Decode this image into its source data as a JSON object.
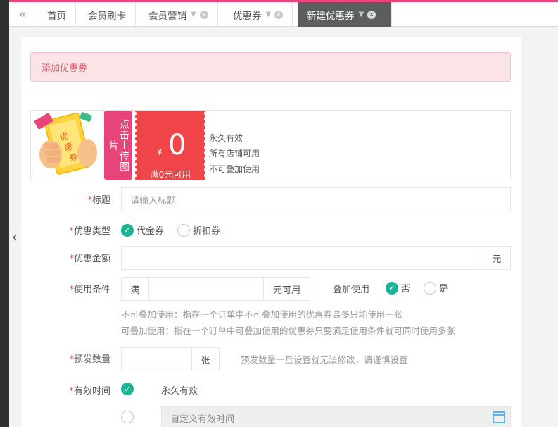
{
  "tabs": {
    "back_icon": "double-chevron-left-icon",
    "items": [
      {
        "label": "首页",
        "active": false,
        "pinned": false,
        "closable": false
      },
      {
        "label": "会员刷卡",
        "active": false,
        "pinned": false,
        "closable": false
      },
      {
        "label": "会员营销",
        "active": false,
        "pinned": true,
        "closable": true
      },
      {
        "label": "优惠券",
        "active": false,
        "pinned": true,
        "closable": true
      },
      {
        "label": "新建优惠券",
        "active": true,
        "pinned": true,
        "closable": true
      }
    ]
  },
  "alert": {
    "text": "添加优惠券"
  },
  "preview": {
    "image_icon": "coupon-hand-illustration",
    "upload_label": "点击上传图片",
    "coupon": {
      "currency": "¥",
      "amount": "0",
      "condition": "满0元可用"
    },
    "info": [
      "永久有效",
      "所有店铺可用",
      "不可叠加使用"
    ]
  },
  "form": {
    "required_mark": "*",
    "title": {
      "label": "标题",
      "placeholder": "请输入标题",
      "value": ""
    },
    "type": {
      "label": "优惠类型",
      "options": [
        {
          "label": "代金券",
          "checked": true
        },
        {
          "label": "折扣券",
          "checked": false
        }
      ]
    },
    "amount": {
      "label": "优惠金额",
      "value": "",
      "unit": "元"
    },
    "condition": {
      "label": "使用条件",
      "prefix": "满",
      "value": "",
      "suffix": "元可用",
      "stack_label": "叠加使用",
      "stack_options": [
        {
          "label": "否",
          "checked": true
        },
        {
          "label": "是",
          "checked": false
        }
      ],
      "help": [
        "不可叠加使用：指在一个订单中不可叠加使用的优惠券最多只能使用一张",
        "可叠加使用：指在一个订单中可叠加使用的优惠券只要满足使用条件就可同时使用多张"
      ]
    },
    "quantity": {
      "label": "预发数量",
      "value": "",
      "unit": "张",
      "help": "预发数量一旦设置就无法修改，请谨慎设置"
    },
    "validity": {
      "label": "有效时间",
      "options": [
        {
          "label": "永久有效",
          "checked": true
        },
        {
          "label": "",
          "checked": false
        }
      ],
      "custom_placeholder": "自定义有效时间"
    }
  },
  "colors": {
    "accent": "#e8447a",
    "coupon_red": "#f0464a",
    "check_green": "#1ab394",
    "alert_bg": "#fbe3e6"
  }
}
